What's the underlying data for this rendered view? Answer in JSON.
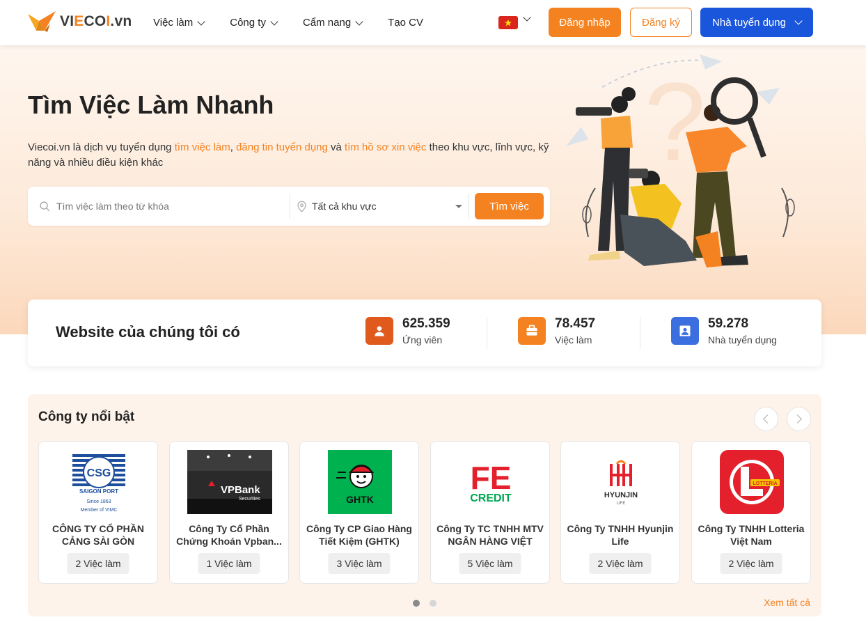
{
  "header": {
    "logo": {
      "text_pre": "VI",
      "text_o": "E",
      "text_mid": "CO",
      "text_i": "I",
      "text_post": ".vn"
    },
    "nav": [
      {
        "label": "Việc làm",
        "has_dropdown": true
      },
      {
        "label": "Công ty",
        "has_dropdown": true
      },
      {
        "label": "Cẩm nang",
        "has_dropdown": true
      },
      {
        "label": "Tạo CV",
        "has_dropdown": false
      }
    ],
    "language": "vi",
    "login_label": "Đăng nhập",
    "register_label": "Đăng ký",
    "employer_label": "Nhà tuyển dụng"
  },
  "hero": {
    "title": "Tìm Việc Làm Nhanh",
    "desc_1": "Viecoi.vn là dịch vụ tuyển dụng ",
    "link_1": "tìm việc làm",
    "desc_2": ", ",
    "link_2": "đăng tin tuyển dụng",
    "desc_3": " và ",
    "link_3": "tìm hồ sơ xin việc",
    "desc_4": " theo khu vực, lĩnh vực, kỹ năng và nhiều điều kiện khác",
    "search": {
      "keyword_placeholder": "Tìm việc làm theo từ khóa",
      "location_value": "Tất cả khu vực",
      "button_label": "Tìm việc"
    }
  },
  "stats": {
    "title": "Website của chúng tôi có",
    "items": [
      {
        "value": "625.359",
        "label": "Ứng viên",
        "icon": "candidate-icon",
        "color": "#e05a1d"
      },
      {
        "value": "78.457",
        "label": "Việc làm",
        "icon": "briefcase-icon",
        "color": "#f58220"
      },
      {
        "value": "59.278",
        "label": "Nhà tuyển dụng",
        "icon": "employer-icon",
        "color": "#3b6fe0"
      }
    ]
  },
  "featured": {
    "title": "Công ty nổi bật",
    "see_all": "Xem tất cả",
    "companies": [
      {
        "name": "CÔNG TY CỔ PHẦN CẢNG SÀI GÒN",
        "jobs": "2 Việc làm",
        "logo": "saigon-port-logo"
      },
      {
        "name": "Công Ty Cổ Phần Chứng Khoán Vpban...",
        "jobs": "1 Việc làm",
        "logo": "vpbank-securities-logo"
      },
      {
        "name": "Công Ty CP Giao Hàng Tiết Kiệm (GHTK)",
        "jobs": "3 Việc làm",
        "logo": "ghtk-logo"
      },
      {
        "name": "Công Ty TC TNHH MTV NGÂN HÀNG VIỆT NA...",
        "jobs": "5 Việc làm",
        "logo": "fe-credit-logo"
      },
      {
        "name": "Công Ty TNHH Hyunjin Life",
        "jobs": "2 Việc làm",
        "logo": "hyunjin-life-logo"
      },
      {
        "name": "Công Ty TNHH Lotteria Việt Nam",
        "jobs": "2 Việc làm",
        "logo": "lotteria-logo"
      }
    ],
    "logo_text": {
      "csg_top": "CSG",
      "csg_ring": "SAIGON PORT",
      "csg_since": "Since 1863",
      "csg_member": "Member of VIMC",
      "vpbank": "VPBank",
      "vpbank_sub": "Securities",
      "ghtk": "GHTK",
      "fe_1": "FE",
      "fe_2": "CREDIT",
      "hyunjin": "HYUNJIN",
      "hyunjin_sub": "LIFE",
      "lotteria": "LOTTERIA"
    },
    "pager": {
      "pages": 2,
      "active": 1
    }
  }
}
